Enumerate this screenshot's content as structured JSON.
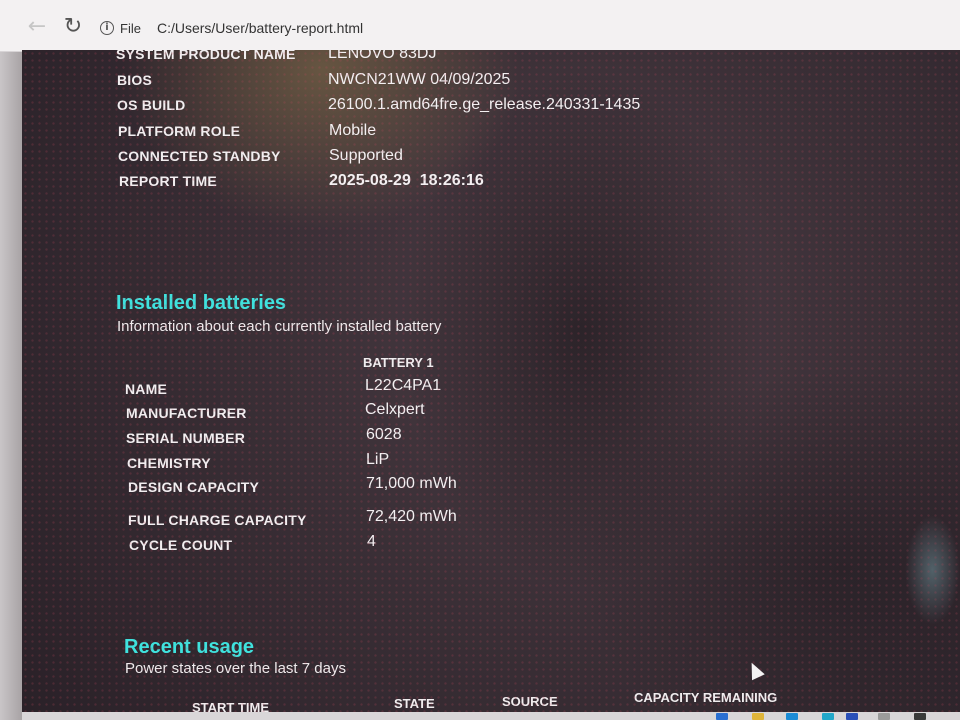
{
  "browser": {
    "file_label": "File",
    "url": "C:/Users/User/battery-report.html"
  },
  "system": [
    {
      "label": "SYSTEM PRODUCT NAME",
      "value": "LENOVO 83DJ"
    },
    {
      "label": "BIOS",
      "value": "NWCN21WW 04/09/2025"
    },
    {
      "label": "OS BUILD",
      "value": "26100.1.amd64fre.ge_release.240331-1435"
    },
    {
      "label": "PLATFORM ROLE",
      "value": "Mobile"
    },
    {
      "label": "CONNECTED STANDBY",
      "value": "Supported"
    },
    {
      "label": "REPORT TIME",
      "value": "2025-08-29  18:26:16"
    }
  ],
  "installed_batteries": {
    "title": "Installed batteries",
    "subtitle": "Information about each currently installed battery",
    "column_header": "BATTERY 1",
    "rows": [
      {
        "label": "NAME",
        "value": "L22C4PA1"
      },
      {
        "label": "MANUFACTURER",
        "value": "Celxpert"
      },
      {
        "label": "SERIAL NUMBER",
        "value": "6028"
      },
      {
        "label": "CHEMISTRY",
        "value": "LiP"
      },
      {
        "label": "DESIGN CAPACITY",
        "value": "71,000 mWh"
      },
      {
        "label": "FULL CHARGE CAPACITY",
        "value": "72,420 mWh"
      },
      {
        "label": "CYCLE COUNT",
        "value": "4"
      }
    ]
  },
  "recent_usage": {
    "title": "Recent usage",
    "subtitle": "Power states over the last 7 days",
    "columns": [
      "START TIME",
      "STATE",
      "SOURCE",
      "CAPACITY REMAINING"
    ]
  },
  "colors": {
    "section_title": "#3fe2de",
    "text": "#f2eef0"
  }
}
